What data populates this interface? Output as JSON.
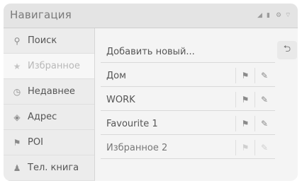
{
  "header": {
    "title": "Навигация"
  },
  "status": {
    "icons": [
      "signal-icon",
      "battery-icon",
      "settings-icon",
      "wifi-icon"
    ]
  },
  "sidebar": {
    "items": [
      {
        "label": "Поиск",
        "icon": "search-icon",
        "active": false
      },
      {
        "label": "Избранное",
        "icon": "star-icon",
        "active": true
      },
      {
        "label": "Недавнее",
        "icon": "clock-icon",
        "active": false
      },
      {
        "label": "Адрес",
        "icon": "address-icon",
        "active": false
      },
      {
        "label": "POI",
        "icon": "poi-icon",
        "active": false
      },
      {
        "label": "Тел. книга",
        "icon": "contact-icon",
        "active": false
      }
    ]
  },
  "main": {
    "add_new_label": "Добавить новый...",
    "favorites": [
      {
        "label": "Дом",
        "enabled": true
      },
      {
        "label": "WORK",
        "enabled": true
      },
      {
        "label": "Favourite 1",
        "enabled": true
      },
      {
        "label": "Избранное 2",
        "enabled": false
      }
    ]
  },
  "colors": {
    "background": "#f4f4f4",
    "sidebar": "#ececec",
    "active": "#f7f7f7"
  }
}
